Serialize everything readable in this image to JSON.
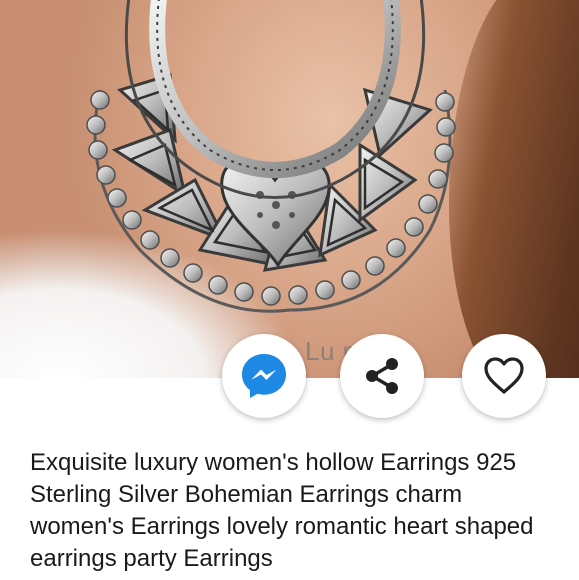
{
  "product": {
    "watermark": "Lu      nd        on",
    "title": "Exquisite luxury women's hollow Earrings 925 Sterling Silver Bohemian Earrings charm women's Earrings lovely romantic heart shaped earrings party Earrings"
  },
  "actions": {
    "messenger_icon": "messenger-icon",
    "share_icon": "share-icon",
    "favorite_icon": "heart-icon"
  },
  "colors": {
    "messenger_blue": "#1e88e5",
    "text": "#1a1a1a",
    "icon_dark": "#222222"
  }
}
